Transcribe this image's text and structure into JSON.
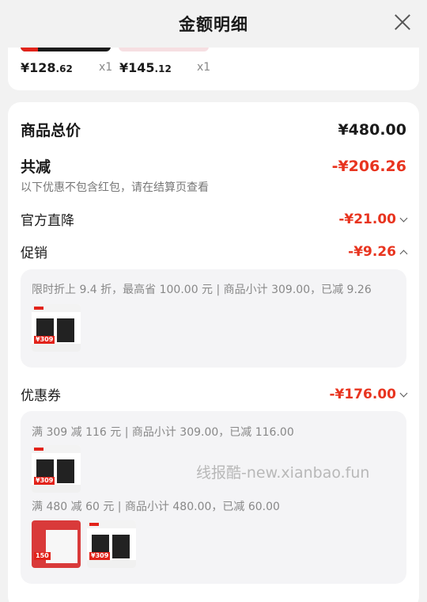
{
  "header": {
    "title": "金额明细"
  },
  "top_items": [
    {
      "price_main": "¥128",
      "price_cents": ".62",
      "qty": "x1"
    },
    {
      "price_main": "¥145",
      "price_cents": ".12",
      "qty": "x1"
    }
  ],
  "summary": {
    "total_label": "商品总价",
    "total_value": "¥480.00",
    "reduce_label": "共减",
    "reduce_value": "-¥206.26",
    "reduce_note": "以下优惠不包含红包，请在结算页查看"
  },
  "discounts": {
    "official": {
      "label": "官方直降",
      "value": "-¥21.00"
    },
    "promo": {
      "label": "促销",
      "value": "-¥9.26",
      "detail": "限时折上 9.4 折，最高省 100.00 元 | 商品小计 309.00，已减 9.26",
      "tag": "¥309"
    },
    "coupon": {
      "label": "优惠券",
      "value": "-¥176.00",
      "detail1": "满 309 减 116 元 | 商品小计 309.00，已减 116.00",
      "detail2": "满 480 减 60 元 | 商品小计 480.00，已减 60.00",
      "tag1": "¥309",
      "tag2": "150",
      "tag3": "¥309"
    }
  },
  "watermark": "线报酷-new.xianbao.fun",
  "colors": {
    "accent_red": "#e8341f",
    "bg": "#f2f2f2"
  }
}
